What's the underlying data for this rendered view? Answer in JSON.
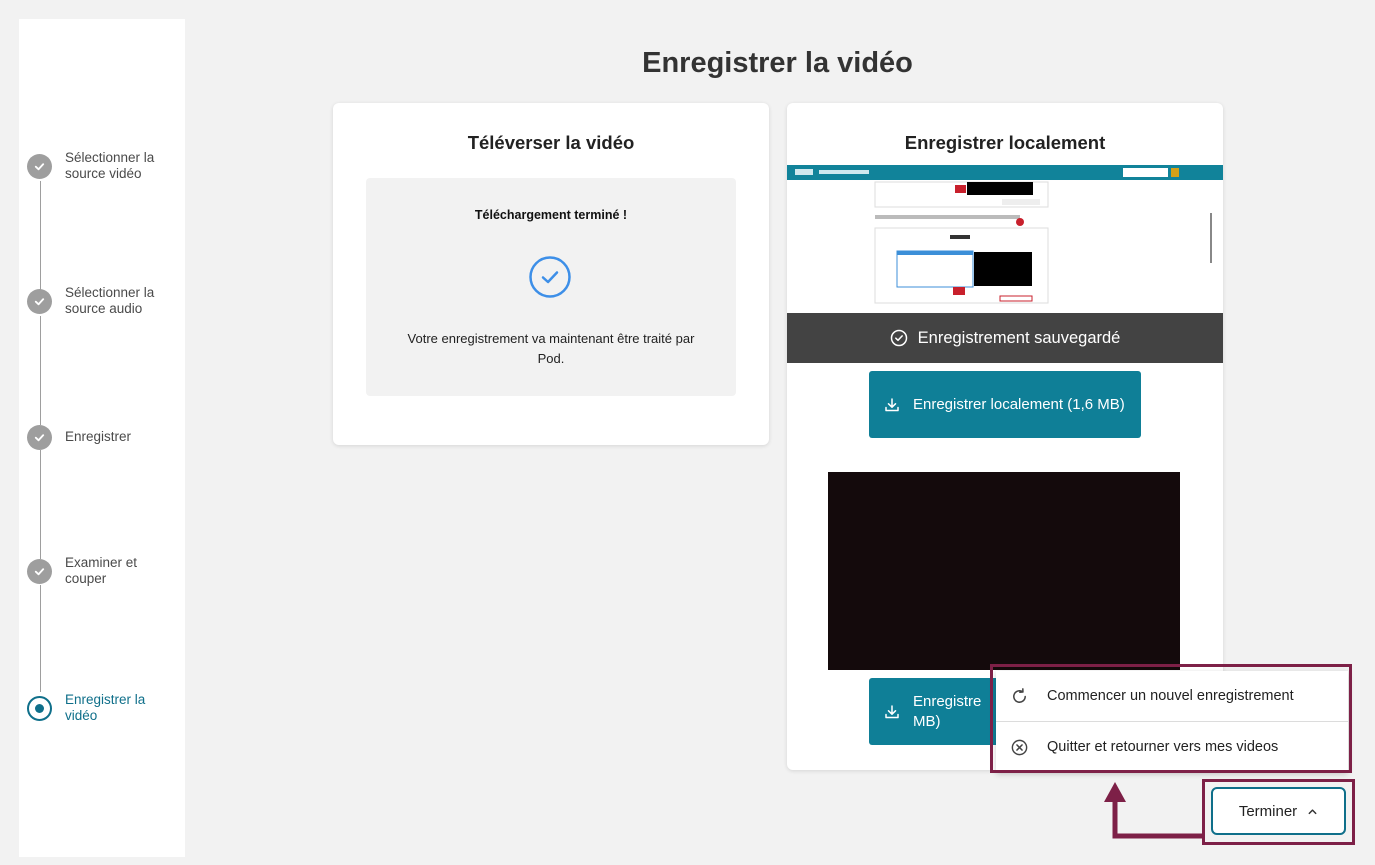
{
  "page": {
    "title": "Enregistrer la vidéo"
  },
  "steps": [
    {
      "label": "Sélectionner la source vidéo",
      "state": "done"
    },
    {
      "label": "Sélectionner la source audio",
      "state": "done"
    },
    {
      "label": "Enregistrer",
      "state": "done"
    },
    {
      "label": "Examiner et couper",
      "state": "done"
    },
    {
      "label": "Enregistrer la vidéo",
      "state": "active"
    }
  ],
  "upload_card": {
    "title": "Téléverser la vidéo",
    "status": "Téléchargement terminé !",
    "message": "Votre enregistrement va maintenant être traité par Pod."
  },
  "local_card": {
    "title": "Enregistrer localement",
    "saved_banner": "Enregistrement sauvegardé",
    "download_screen_label": "Enregistrer localement (1,6 MB)",
    "download_camera_label": "Enregistre MB)"
  },
  "menu": {
    "items": [
      {
        "label": "Commencer un nouvel enregistrement",
        "icon": "refresh-icon"
      },
      {
        "label": "Quitter et retourner vers mes videos",
        "icon": "close-circle-icon"
      }
    ]
  },
  "footer": {
    "finish_label": "Terminer"
  },
  "colors": {
    "accent": "#0f7f97",
    "highlight": "#7d2047",
    "done_step": "#9e9e9e"
  }
}
